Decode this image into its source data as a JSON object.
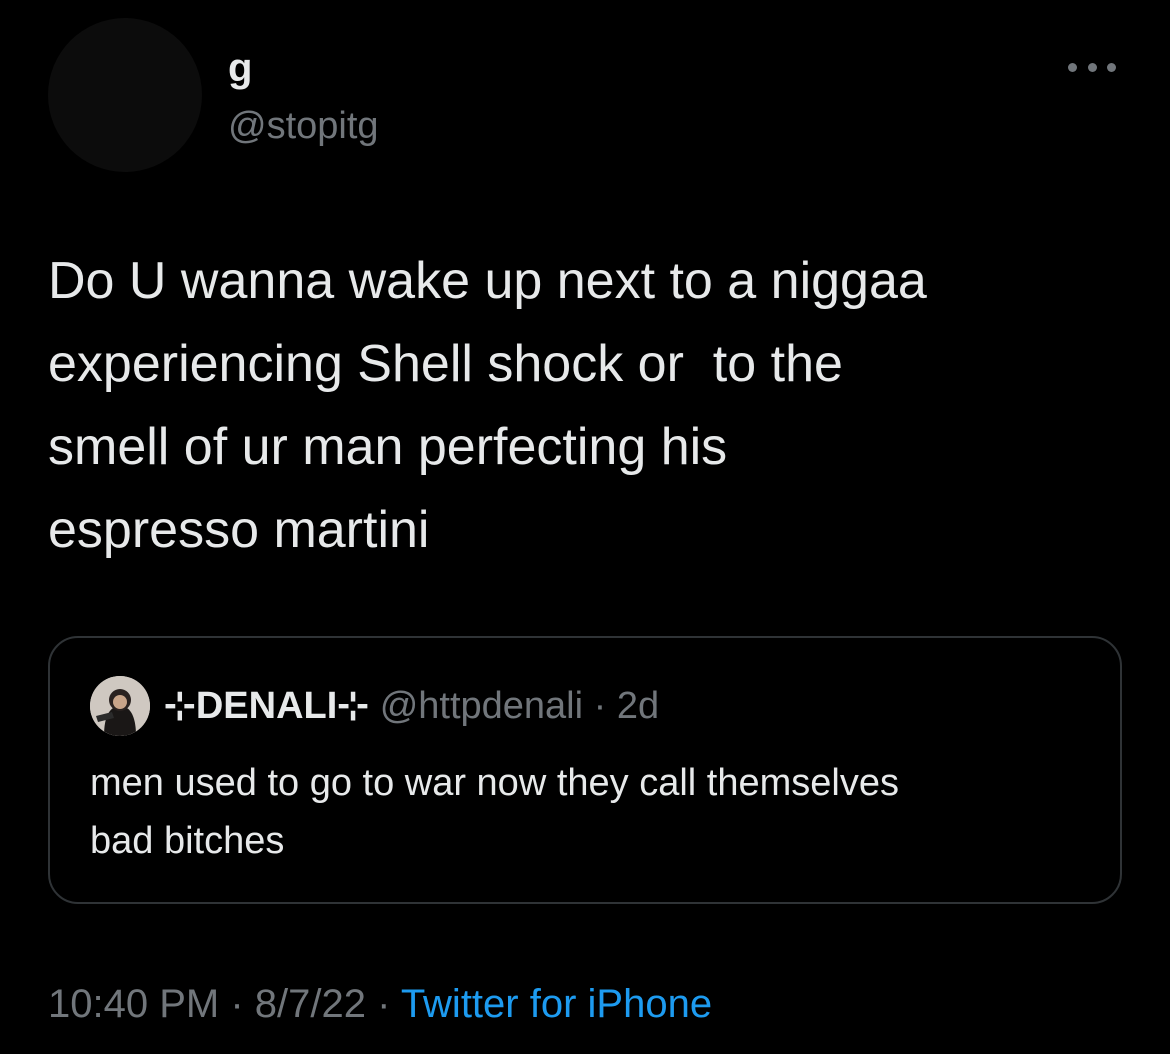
{
  "author": {
    "display_name": "g",
    "handle": "@stopitg"
  },
  "more_menu_icon": "more-horizontal-icon",
  "tweet": {
    "lines": [
      "Do U wanna wake up next to a niggaa",
      "experiencing Shell shock or  to the",
      "smell of ur man perfecting his",
      "espresso martini"
    ]
  },
  "quoted_tweet": {
    "display_name": "⊹DENALI⊹",
    "handle": "@httpdenali",
    "separator": "·",
    "age": "2d",
    "lines": [
      "men used to go to war now they call themselves",
      "bad bitches"
    ]
  },
  "meta": {
    "time": "10:40 PM",
    "sep1": " · ",
    "date": "8/7/22",
    "sep2": " · ",
    "source": "Twitter for iPhone"
  },
  "colors": {
    "background": "#000000",
    "text_primary": "#e7e9ea",
    "text_secondary": "#71767b",
    "accent": "#1d9bf0",
    "border": "#2f3336"
  }
}
